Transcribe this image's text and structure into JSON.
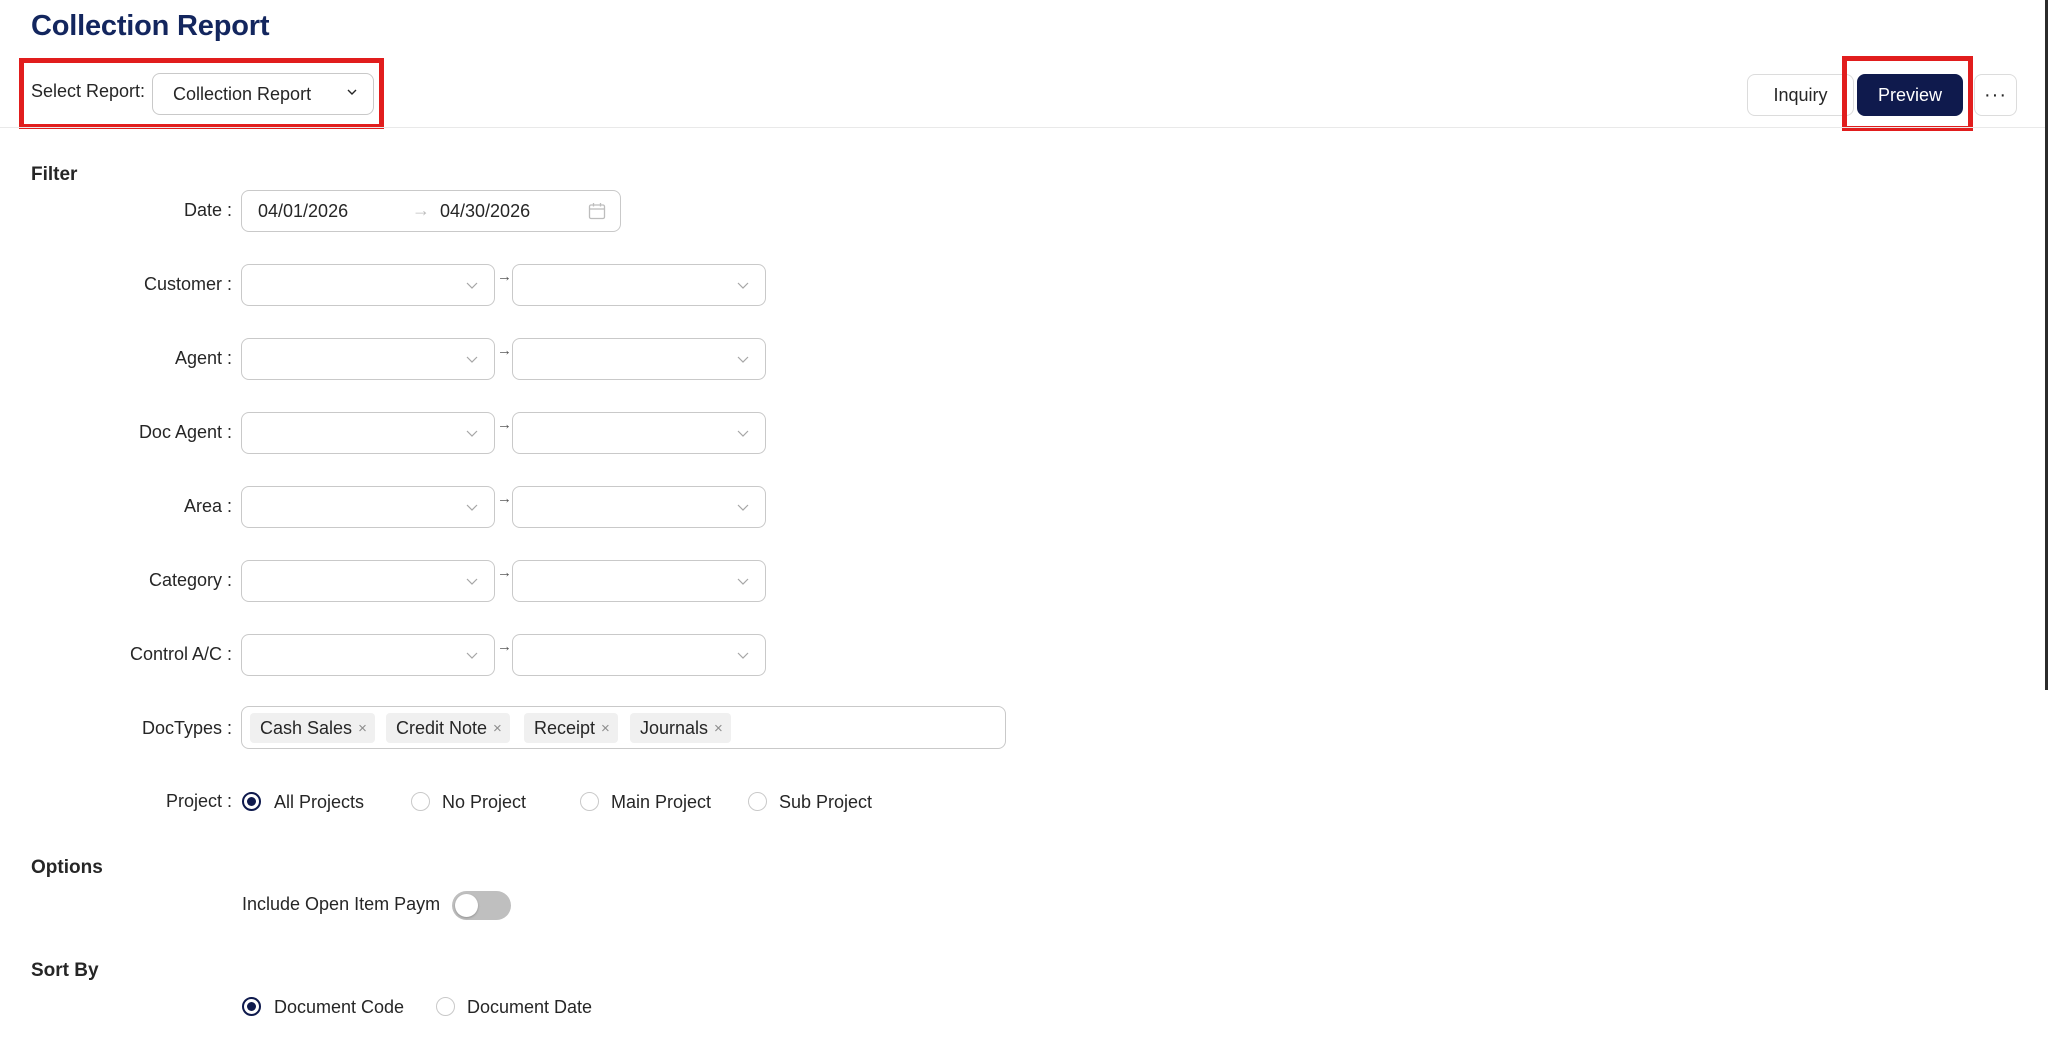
{
  "page": {
    "title": "Collection Report"
  },
  "header": {
    "select_report_label": "Select Report:",
    "select_report_value": "Collection Report",
    "buttons": {
      "inquiry": "Inquiry",
      "preview": "Preview",
      "more": "···"
    }
  },
  "filter": {
    "title": "Filter",
    "date": {
      "label": "Date :",
      "from": "04/01/2026",
      "separator": "→",
      "to": "04/30/2026"
    },
    "range_separator": "→",
    "ranges": [
      {
        "label": "Customer :"
      },
      {
        "label": "Agent :"
      },
      {
        "label": "Doc Agent :"
      },
      {
        "label": "Area :"
      },
      {
        "label": "Category :"
      },
      {
        "label": "Control A/C :"
      }
    ],
    "doctypes": {
      "label": "DocTypes :",
      "tags": [
        "Cash Sales",
        "Credit Note",
        "Receipt",
        "Journals"
      ],
      "remove_glyph": "×"
    },
    "project": {
      "label": "Project :",
      "options": [
        "All Projects",
        "No Project",
        "Main Project",
        "Sub Project"
      ],
      "selected": "All Projects"
    }
  },
  "options": {
    "title": "Options",
    "include_open_item_label": "Include Open Item Paym",
    "include_open_item_enabled": false
  },
  "sort_by": {
    "title": "Sort By",
    "options": [
      "Document Code",
      "Document Date"
    ],
    "selected": "Document Code"
  },
  "colors": {
    "accent": "#0f1a4d",
    "title": "#13265e",
    "highlight": "#e11d1d"
  }
}
